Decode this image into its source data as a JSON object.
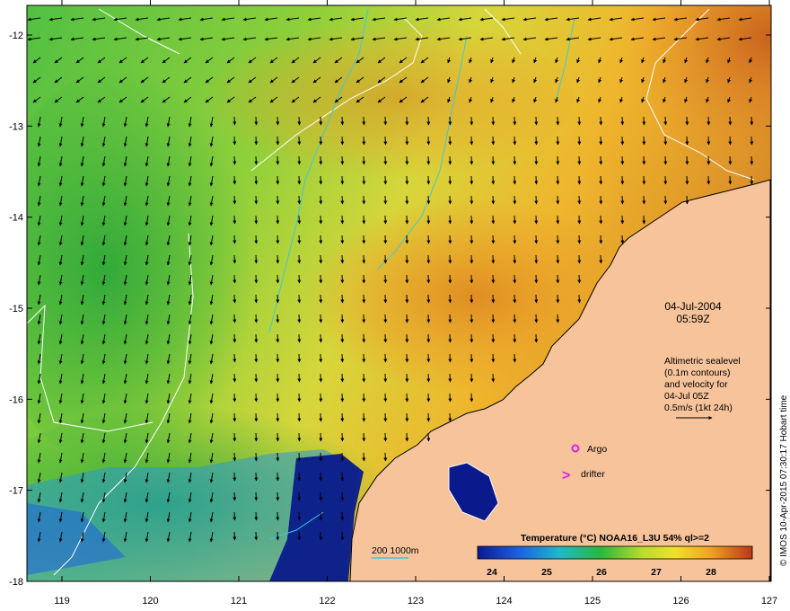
{
  "map": {
    "date": "04-Jul-2004",
    "time": "05:59Z",
    "altimetry_lines": [
      "Altimetric sealevel",
      "(0.1m contours)",
      "and velocity for",
      "04-Jul 05Z",
      "0.5m/s (1kt 24h)"
    ],
    "argo_label": "Argo",
    "drifter_label": "drifter",
    "drifter_symbol": ">",
    "bathymetry_label": "200  1000m",
    "colorbar_title": "Temperature (°C) NOAA16_L3U 54% ql>=2",
    "colorbar_ticks": [
      "24",
      "25",
      "26",
      "27",
      "28"
    ],
    "credit": "© IMOS 10-Apr-2015 07:30:17 Hobart time",
    "x_ticks": [
      "119",
      "120",
      "121",
      "122",
      "123",
      "124",
      "125",
      "126",
      "127"
    ],
    "y_ticks": [
      "-12",
      "-13",
      "-14",
      "-15",
      "-16",
      "-17",
      "-18"
    ],
    "colors": {
      "land": "#f7c39a",
      "warm": "#e8a020",
      "cool": "#3fb83f",
      "cold": "#0a1a8c",
      "argo": "#e020e0",
      "drifter": "#e020e0",
      "isobath": "#40c8d8",
      "contour": "#ffffff"
    }
  }
}
